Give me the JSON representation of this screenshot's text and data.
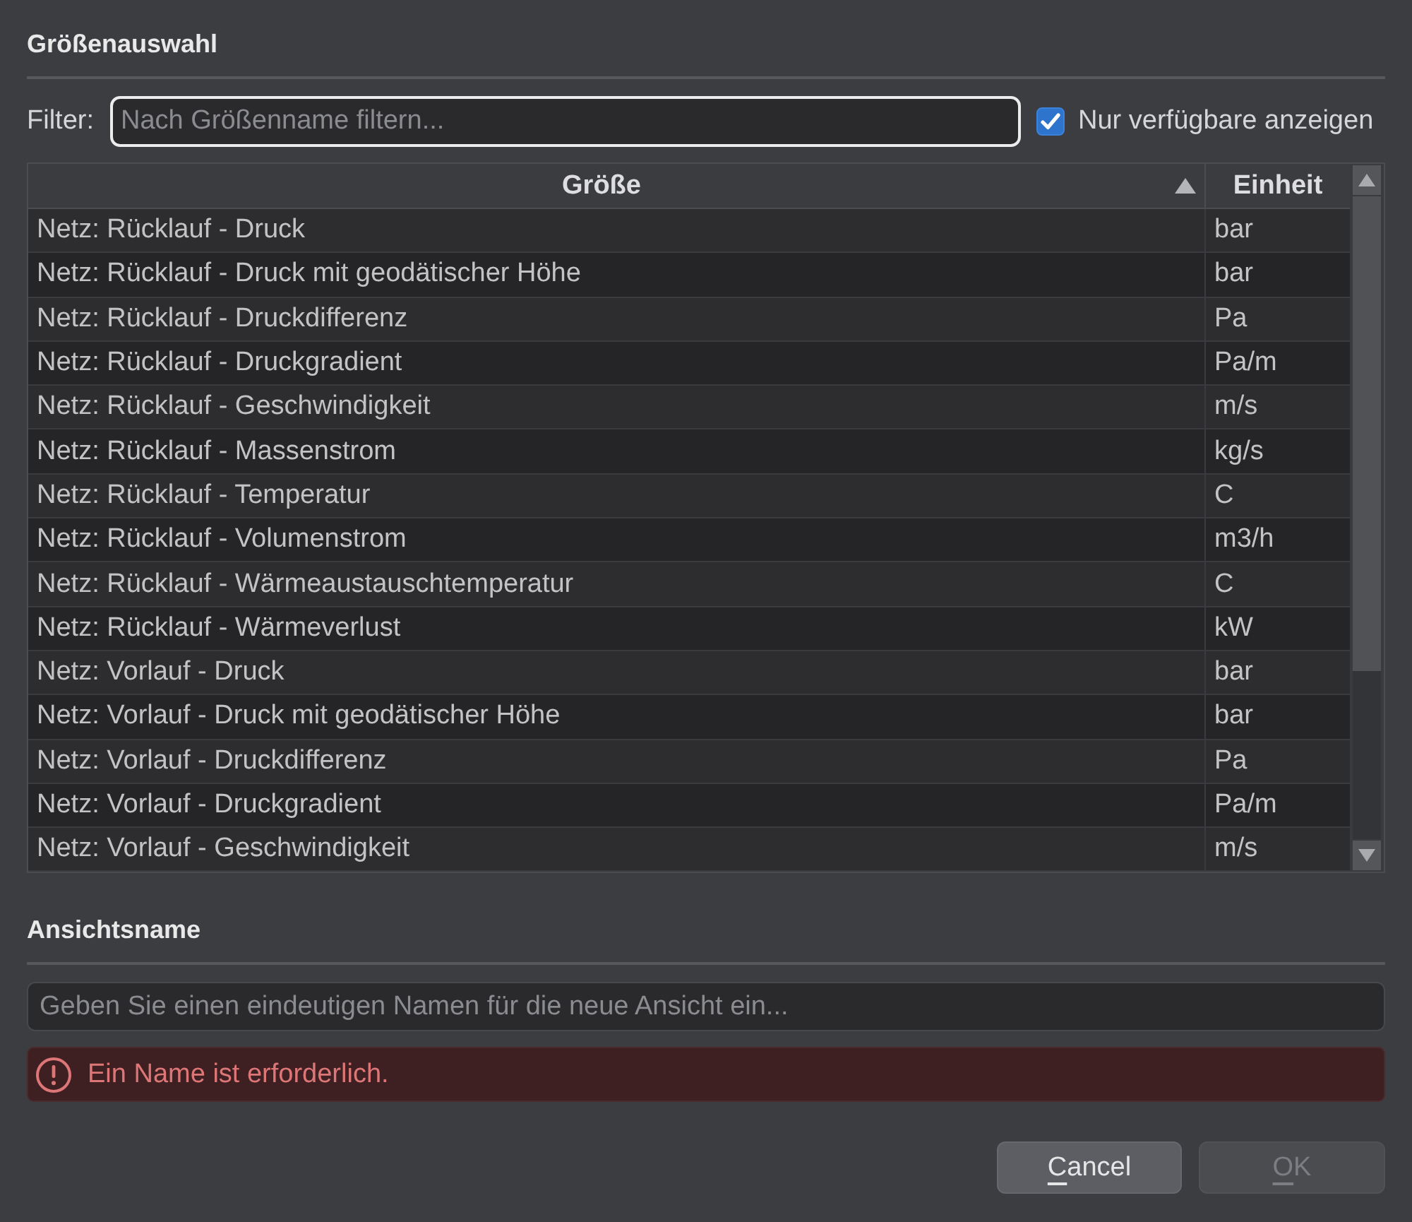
{
  "quantity_selection": {
    "title": "Größenauswahl",
    "filter": {
      "label": "Filter:",
      "placeholder": "Nach Größenname filtern...",
      "focused": true
    },
    "available_only": {
      "label": "Nur verfügbare anzeigen",
      "checked": true
    },
    "table": {
      "columns": [
        {
          "label": "Größe",
          "sorted": true,
          "descending": false
        },
        {
          "label": "Einheit",
          "sorted": false
        }
      ],
      "rows": [
        {
          "name": "Netz: Rücklauf - Druck",
          "unit": "bar",
          "selected": false
        },
        {
          "name": "Netz: Rücklauf - Druck mit geodätischer Höhe",
          "unit": "bar",
          "selected": false
        },
        {
          "name": "Netz: Rücklauf - Druckdifferenz",
          "unit": "Pa",
          "selected": false
        },
        {
          "name": "Netz: Rücklauf - Druckgradient",
          "unit": "Pa/m",
          "selected": false
        },
        {
          "name": "Netz: Rücklauf - Geschwindigkeit",
          "unit": "m/s",
          "selected": false
        },
        {
          "name": "Netz: Rücklauf - Massenstrom",
          "unit": "kg/s",
          "selected": false
        },
        {
          "name": "Netz: Rücklauf - Temperatur",
          "unit": "C",
          "selected": false
        },
        {
          "name": "Netz: Rücklauf - Volumenstrom",
          "unit": "m3/h",
          "selected": false
        },
        {
          "name": "Netz: Rücklauf - Wärmeaustauschtemperatur",
          "unit": "C",
          "selected": false
        },
        {
          "name": "Netz: Rücklauf - Wärmeverlust",
          "unit": "kW",
          "selected": false
        },
        {
          "name": "Netz: Vorlauf - Druck",
          "unit": "bar",
          "selected": false
        },
        {
          "name": "Netz: Vorlauf - Druck mit geodätischer Höhe",
          "unit": "bar",
          "selected": false
        },
        {
          "name": "Netz: Vorlauf - Druckdifferenz",
          "unit": "Pa",
          "selected": false
        },
        {
          "name": "Netz: Vorlauf - Druckgradient",
          "unit": "Pa/m",
          "selected": false
        },
        {
          "name": "Netz: Vorlauf - Geschwindigkeit",
          "unit": "m/s",
          "selected": false
        }
      ]
    }
  },
  "view_name": {
    "title": "Ansichtsname",
    "input": {
      "placeholder": "Geben Sie einen eindeutigen Namen für die neue Ansicht ein...",
      "focused": false
    },
    "error": {
      "message": "Ein Name ist erforderlich."
    }
  },
  "buttons": [
    {
      "label": "Cancel",
      "mnemonic": true,
      "disabled": false
    },
    {
      "label": "OK",
      "mnemonic": true,
      "disabled": true
    }
  ]
}
